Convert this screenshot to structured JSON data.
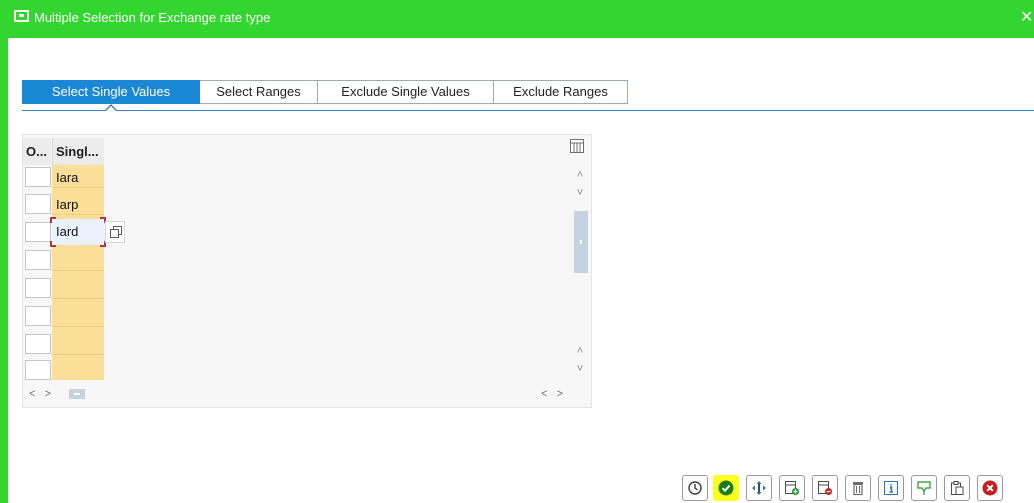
{
  "window": {
    "title": "Multiple Selection for Exchange rate type",
    "title_icon": "dialog-icon",
    "close_glyph": "✕",
    "accent_color": "#33d62f"
  },
  "tabs": [
    {
      "label": "Select Single Values",
      "active": true
    },
    {
      "label": "Select Ranges",
      "active": false
    },
    {
      "label": "Exclude Single Values",
      "active": false
    },
    {
      "label": "Exclude Ranges",
      "active": false
    }
  ],
  "grid": {
    "columns": [
      "O...",
      "Singl..."
    ],
    "values": [
      "Iara",
      "Iarp",
      "Iard",
      "",
      "",
      "",
      "",
      ""
    ],
    "active_row": 3,
    "cell_color": "#fbde97",
    "scroll_arrows": {
      "up": "˄",
      "down": "˅",
      "left": "<",
      "right": ">"
    }
  },
  "toolbar": {
    "buttons": [
      {
        "name": "execute-button",
        "icon": "clock-arrow-icon",
        "highlighted": false
      },
      {
        "name": "copy-button",
        "icon": "green-check-icon",
        "highlighted": true
      },
      {
        "name": "move-button",
        "icon": "drag-arrows-icon",
        "highlighted": false
      },
      {
        "name": "insert-row-button",
        "icon": "insert-row-icon",
        "highlighted": false
      },
      {
        "name": "delete-row-button",
        "icon": "delete-row-icon",
        "highlighted": false
      },
      {
        "name": "delete-all-button",
        "icon": "trash-icon",
        "highlighted": false
      },
      {
        "name": "help-button",
        "icon": "info-icon",
        "highlighted": false
      },
      {
        "name": "options-button",
        "icon": "filter-icon",
        "highlighted": false
      },
      {
        "name": "upload-button",
        "icon": "clipboard-icon",
        "highlighted": false
      },
      {
        "name": "cancel-button",
        "icon": "red-x-icon",
        "highlighted": false
      }
    ]
  }
}
